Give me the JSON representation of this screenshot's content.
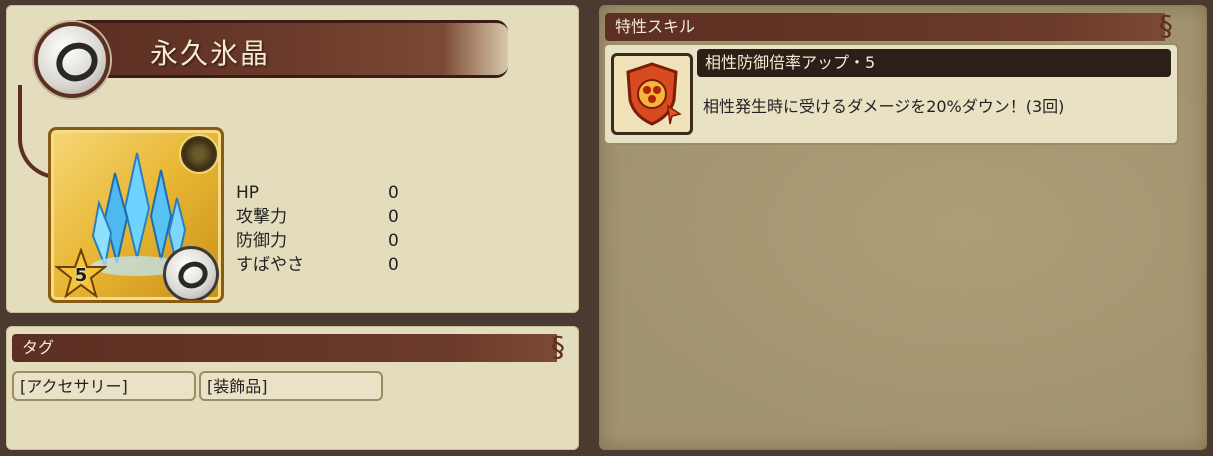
{
  "item": {
    "name": "永久氷晶",
    "rarity": "5",
    "stats": [
      {
        "label": "HP",
        "value": "0"
      },
      {
        "label": "攻撃力",
        "value": "0"
      },
      {
        "label": "防御力",
        "value": "0"
      },
      {
        "label": "すばやさ",
        "value": "0"
      }
    ]
  },
  "tags": {
    "title": "タグ",
    "items": [
      "[アクセサリー]",
      "[装飾品]"
    ]
  },
  "skills": {
    "title": "特性スキル",
    "entries": [
      {
        "name": "相性防御倍率アップ・5",
        "description": "相性発生時に受けるダメージを20%ダウン！(3回)",
        "icon": "shield-elements-icon"
      }
    ]
  },
  "colors": {
    "banner": "#5b2f22",
    "panel": "#e3dcbd",
    "skill_panel": "#a39470",
    "card_gold": "#e8b632"
  },
  "icons": {
    "category": "ring-icon",
    "item_image": "ice-crystal-icon",
    "rarity": "star-icon",
    "corner": "emblem-icon"
  }
}
